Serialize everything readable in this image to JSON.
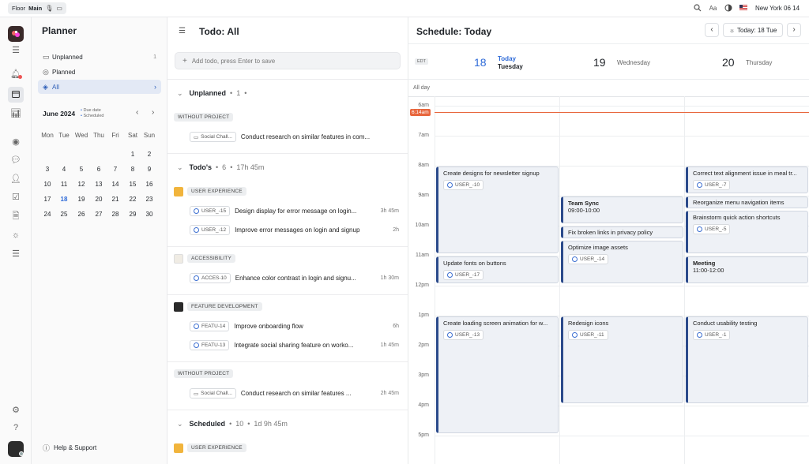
{
  "topbar": {
    "floor_label": "Floor",
    "main_label": "Main",
    "location": "New York",
    "time": "06 14",
    "font_label": "Aa",
    "icons": [
      "search-icon",
      "font-size-icon",
      "theme-toggle-icon",
      "us-flag-icon"
    ]
  },
  "rail": {
    "icons": [
      "app-logo",
      "menu-icon",
      "bell-icon",
      "calendar-icon",
      "chart-icon",
      "user-circle-icon",
      "chat-icon",
      "users-icon",
      "checkbox-icon",
      "document-icon",
      "sun-icon",
      "database-icon",
      "sliders-icon",
      "help-icon",
      "avatar"
    ]
  },
  "planner": {
    "title": "Planner",
    "nav": [
      {
        "label": "Unplanned",
        "count": "1",
        "icon": "inbox-icon"
      },
      {
        "label": "Planned",
        "count": "",
        "icon": "check-circle-icon"
      },
      {
        "label": "All",
        "count": "",
        "icon": "layers-icon"
      }
    ],
    "month_label": "June 2024",
    "legend_due": "Due date",
    "legend_scheduled": "Scheduled",
    "weekdays": [
      "Mon",
      "Tue",
      "Wed",
      "Thu",
      "Fri",
      "Sat",
      "Sun"
    ],
    "weeks": [
      [
        "",
        "",
        "",
        "",
        "",
        "1",
        "2"
      ],
      [
        "3",
        "4",
        "5",
        "6",
        "7",
        "8",
        "9"
      ],
      [
        "10",
        "11",
        "12",
        "13",
        "14",
        "15",
        "16"
      ],
      [
        "17",
        "18",
        "19",
        "20",
        "21",
        "22",
        "23"
      ],
      [
        "24",
        "25",
        "26",
        "27",
        "28",
        "29",
        "30"
      ]
    ],
    "today": "18",
    "help_label": "Help & Support"
  },
  "todos": {
    "title": "Todo: All",
    "add_placeholder": "Add todo, press Enter to save",
    "sections": {
      "unplanned": {
        "title": "Unplanned",
        "count": "1",
        "extra": ""
      },
      "todos": {
        "title": "Todo's",
        "count": "6",
        "extra": "17h 45m"
      },
      "scheduled": {
        "title": "Scheduled",
        "count": "10",
        "extra": "1d 9h 45m"
      }
    },
    "groups": {
      "wp1": "WITHOUT PROJECT",
      "ux": "USER EXPERIENCE",
      "acc": "ACCESSIBILITY",
      "feat": "FEATURE DEVELOPMENT",
      "wp2": "WITHOUT PROJECT",
      "ux2": "USER EXPERIENCE"
    },
    "tasks": {
      "t1": {
        "chip": "Social Chall...",
        "text": "Conduct research on similar features in com...",
        "dur": ""
      },
      "t2": {
        "chip": "USER_-15",
        "text": "Design display for error message on login...",
        "dur": "3h 45m"
      },
      "t3": {
        "chip": "USER_-12",
        "text": "Improve error messages on login and signup",
        "dur": "2h"
      },
      "t4": {
        "chip": "ACCES-10",
        "text": "Enhance color contrast in login and signu...",
        "dur": "1h 30m"
      },
      "t5": {
        "chip": "FEATU-14",
        "text": "Improve onboarding flow",
        "dur": "6h"
      },
      "t6": {
        "chip": "FEATU-13",
        "text": "Integrate social sharing feature on worko...",
        "dur": "1h 45m"
      },
      "t7": {
        "chip": "Social Chall...",
        "text": "Conduct research on similar features ...",
        "dur": "2h 45m"
      }
    }
  },
  "schedule": {
    "title": "Schedule: Today",
    "today_button": "Today: 18 Tue",
    "tz": "EDT",
    "all_day": "All day",
    "now_label": "6:14am",
    "days": [
      {
        "num": "18",
        "label": "Today",
        "sub": "Tuesday"
      },
      {
        "num": "19",
        "label": "Wednesday",
        "sub": ""
      },
      {
        "num": "20",
        "label": "Thursday",
        "sub": ""
      }
    ],
    "hours": [
      "6am",
      "7am",
      "8am",
      "9am",
      "10am",
      "11am",
      "12pm",
      "1pm",
      "2pm",
      "3pm",
      "4pm",
      "5pm"
    ],
    "events": {
      "e1": {
        "title": "Create designs for newsletter signup",
        "chip": "USER_-10"
      },
      "e2": {
        "title": "Update fonts on buttons",
        "chip": "USER_-17"
      },
      "e3": {
        "title": "Create loading screen animation for w...",
        "chip": "USER_-13"
      },
      "e4": {
        "title": "Team Sync",
        "time": "09:00-10:00"
      },
      "e5": {
        "title": "Fix broken links in privacy policy"
      },
      "e6": {
        "title": "Optimize image assets",
        "chip": "USER_-14"
      },
      "e7": {
        "title": "Redesign icons",
        "chip": "USER_-11"
      },
      "e8": {
        "title": "Correct text alignment issue in meal tr...",
        "chip": "USER_-7"
      },
      "e9": {
        "title": "Reorganize menu navigation items"
      },
      "e10": {
        "title": "Brainstorm quick action shortcuts",
        "chip": "USER_-5"
      },
      "e11": {
        "title": "Meeting",
        "time": "11:00-12:00"
      },
      "e12": {
        "title": "Conduct usability testing",
        "chip": "USER_-1"
      }
    },
    "colors": {
      "today": "#2f6bd8",
      "now_line": "#e8663d",
      "event_border": "#2b4a8b"
    }
  }
}
